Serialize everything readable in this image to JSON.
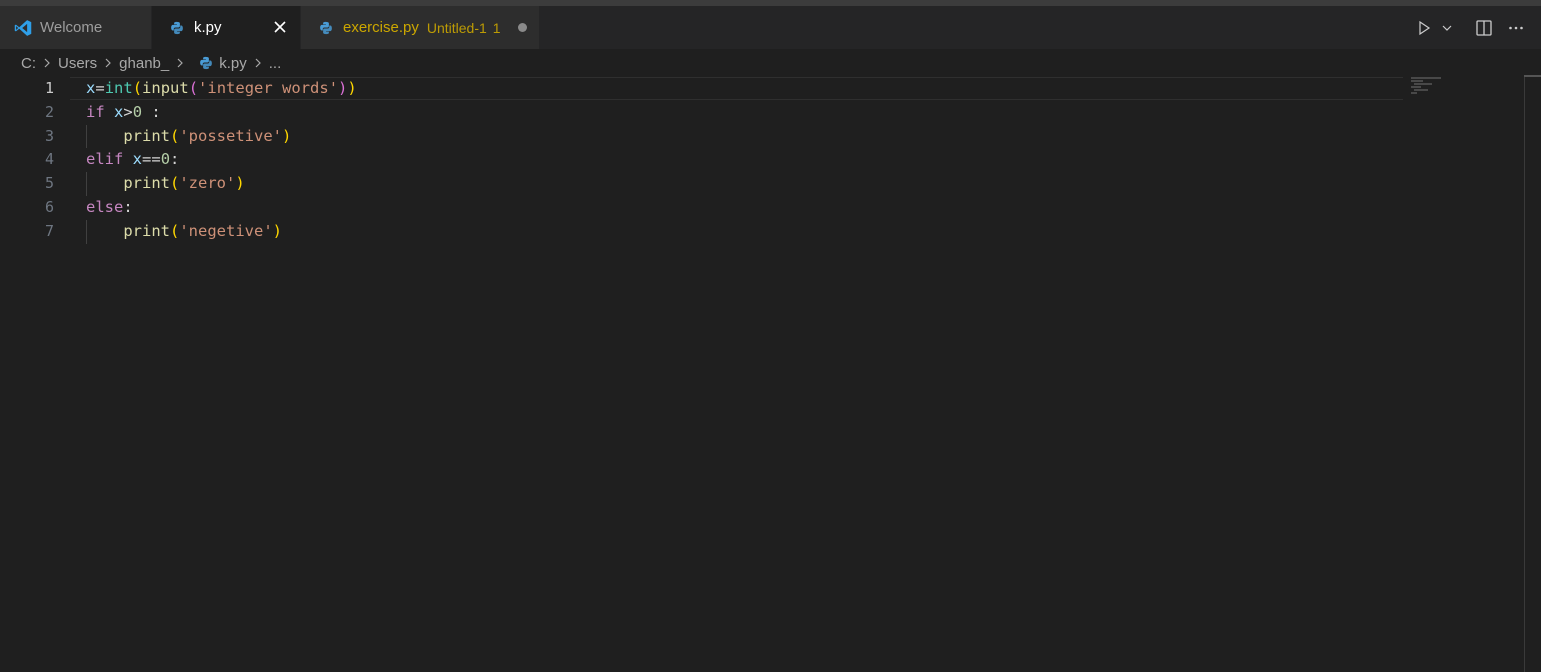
{
  "tabs": {
    "welcome": {
      "label": "Welcome",
      "icon": "vscode-logo-icon"
    },
    "active": {
      "label": "k.py",
      "icon": "python-icon"
    },
    "exercise": {
      "label": "exercise.py",
      "description": "Untitled-1",
      "problems": "1",
      "icon": "python-icon"
    }
  },
  "actions": [
    "run-icon",
    "chevron-down-icon",
    "split-editor-icon",
    "more-actions-icon"
  ],
  "breadcrumb": {
    "drive": "C:",
    "users": "Users",
    "user": "ghanb_",
    "file": "k.py",
    "more": "..."
  },
  "editor": {
    "line_numbers": [
      "1",
      "2",
      "3",
      "4",
      "5",
      "6",
      "7"
    ],
    "active_line": 1,
    "lines": {
      "l1": {
        "var": "x",
        "eq": "=",
        "int": "int",
        "p1": "(",
        "input": "input",
        "p2": "(",
        "str": "'integer words'",
        "p3": ")",
        "p4": ")"
      },
      "l2": {
        "kw": "if",
        "sp": " ",
        "var": "x",
        "op": ">",
        "num": "0",
        "rest": " :"
      },
      "l3": {
        "fn": "print",
        "p1": "(",
        "str": "'possetive'",
        "p2": ")"
      },
      "l4": {
        "kw": "elif",
        "sp": " ",
        "var": "x",
        "op": "==",
        "num": "0",
        "rest": ":"
      },
      "l5": {
        "fn": "print",
        "p1": "(",
        "str": "'zero'",
        "p2": ")"
      },
      "l6": {
        "kw": "else",
        "rest": ":"
      },
      "l7": {
        "fn": "print",
        "p1": "(",
        "str": "'negetive'",
        "p2": ")"
      }
    }
  }
}
